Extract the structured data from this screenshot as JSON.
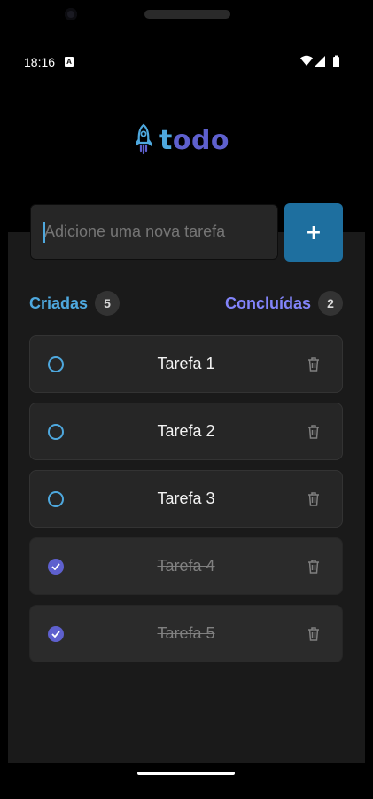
{
  "status_bar": {
    "time": "18:16",
    "notification_icon": "a-box-icon",
    "icons": [
      "wifi-icon",
      "signal-icon",
      "battery-icon"
    ]
  },
  "header": {
    "logo_icon": "rocket-icon",
    "logo_text_first": "t",
    "logo_text_rest": "odo",
    "colors": {
      "primary": "#4ea8de",
      "secondary": "#5e60ce"
    }
  },
  "new_task": {
    "placeholder": "Adicione uma nova tarefa",
    "value": "",
    "add_label": "+"
  },
  "counters": {
    "created_label": "Criadas",
    "created_count": "5",
    "done_label": "Concluídas",
    "done_count": "2"
  },
  "tasks": [
    {
      "title": "Tarefa 1",
      "done": false
    },
    {
      "title": "Tarefa 2",
      "done": false
    },
    {
      "title": "Tarefa 3",
      "done": false
    },
    {
      "title": "Tarefa 4",
      "done": true
    },
    {
      "title": "Tarefa 5",
      "done": true
    }
  ]
}
